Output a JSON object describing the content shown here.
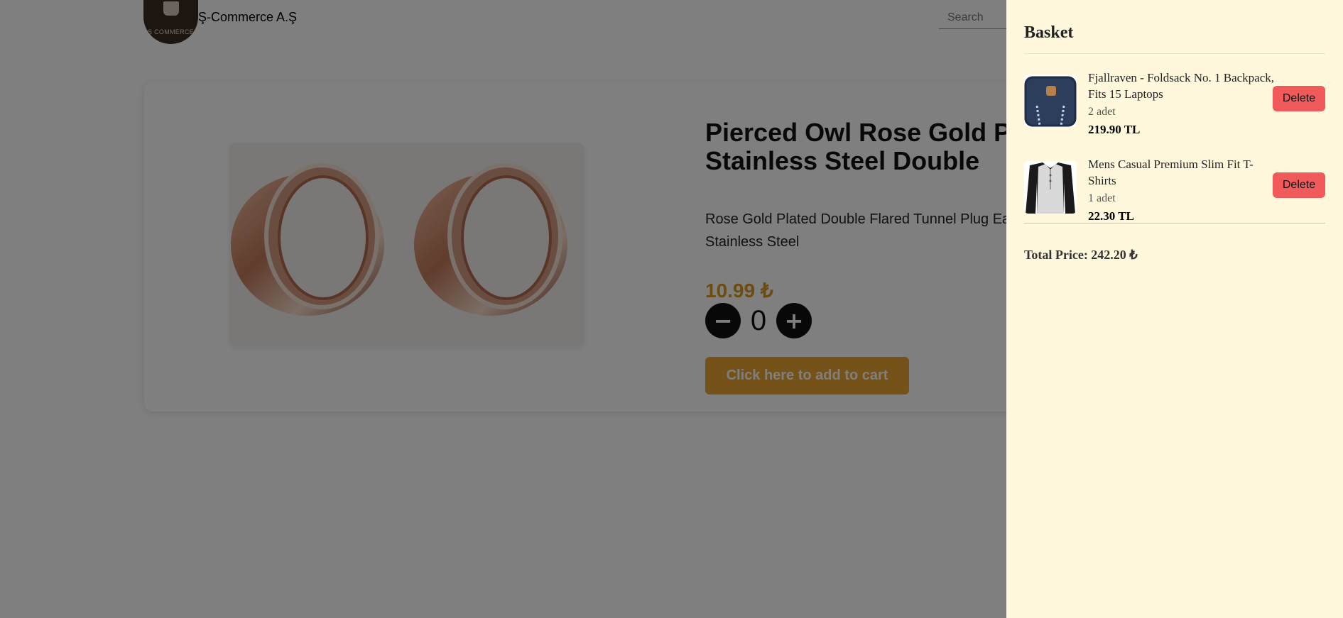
{
  "header": {
    "logo_text": "Ş COMMERCE",
    "brand": "Ş-Commerce A.Ş",
    "search_placeholder": "Search"
  },
  "product": {
    "title": "Pierced Owl Rose Gold Plated\nStainless Steel Double",
    "description": "Rose Gold Plated Double Flared Tunnel Plug Earrings.\nStainless Steel",
    "price": "10.99 ₺",
    "quantity": "0",
    "minus_label": "−",
    "plus_label": "+",
    "add_to_cart_label": "Click here to add to cart",
    "image_icon": "rose-gold-tunnel-plug-image"
  },
  "basket": {
    "title": "Basket",
    "items": [
      {
        "name": "Fjallraven - Foldsack No. 1 Backpack, Fits 15 Laptops",
        "quantity": "2 adet",
        "price": "219.90 TL",
        "delete_label": "Delete",
        "thumb_icon": "backpack-thumbnail"
      },
      {
        "name": "Mens Casual Premium Slim Fit T-Shirts",
        "quantity": "1 adet",
        "price": "22.30 TL",
        "delete_label": "Delete",
        "thumb_icon": "tshirt-thumbnail"
      }
    ],
    "total": "Total Price: 242.20 ₺"
  },
  "colors": {
    "accent": "#e8a530",
    "drawer_bg": "#fff8dc",
    "delete": "#f05a5a"
  }
}
